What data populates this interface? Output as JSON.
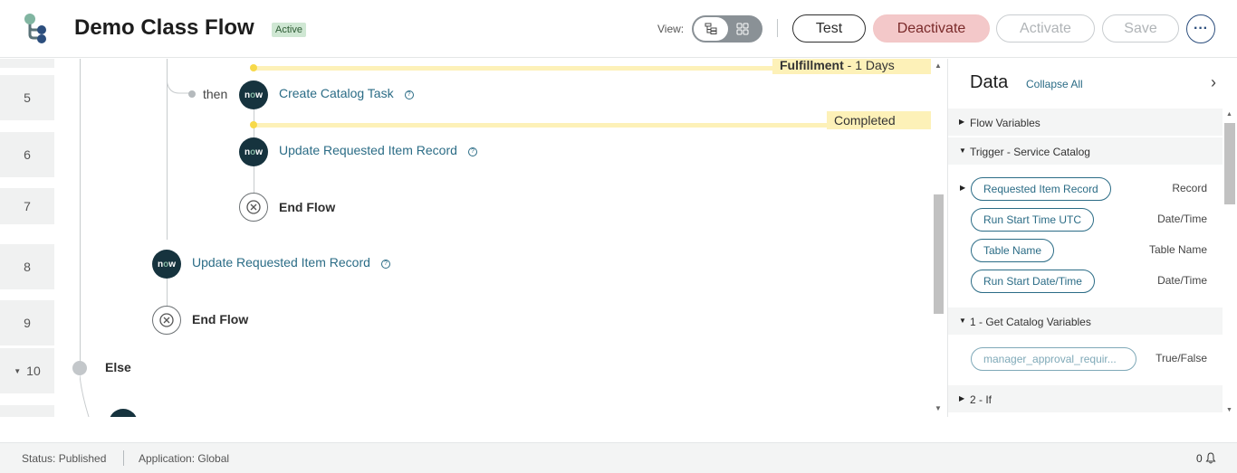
{
  "header": {
    "title": "Demo Class Flow",
    "badge": "Active",
    "view_label": "View:",
    "buttons": {
      "test": "Test",
      "deactivate": "Deactivate",
      "activate": "Activate",
      "save": "Save",
      "more": "···"
    }
  },
  "flow": {
    "row_numbers": [
      "5",
      "6",
      "7",
      "8",
      "9",
      "10"
    ],
    "then_label": "then",
    "steps": {
      "create_catalog_task": "Create Catalog Task",
      "update_requested_item_1": "Update Requested Item Record",
      "end_flow_1": "End Flow",
      "update_requested_item_2": "Update Requested Item Record",
      "end_flow_2": "End Flow",
      "else": "Else"
    },
    "stages": {
      "fulfillment_name": "Fulfillment",
      "fulfillment_duration": " - 1 Days",
      "completed": "Completed"
    },
    "now_icon_text": "now"
  },
  "data_panel": {
    "title": "Data",
    "collapse_all": "Collapse All",
    "sections": {
      "flow_variables": "Flow Variables",
      "trigger": "Trigger - Service Catalog",
      "get_catalog_variables": "1 - Get Catalog Variables",
      "if": "2 - If"
    },
    "trigger_pills": [
      {
        "label": "Requested Item Record",
        "type": "Record"
      },
      {
        "label": "Run Start Time UTC",
        "type": "Date/Time"
      },
      {
        "label": "Table Name",
        "type": "Table Name"
      },
      {
        "label": "Run Start Date/Time",
        "type": "Date/Time"
      }
    ],
    "catalog_pills": [
      {
        "label": "manager_approval_requir...",
        "type": "True/False"
      }
    ]
  },
  "footer": {
    "status": "Status: Published",
    "application": "Application: Global",
    "notification_count": "0"
  }
}
